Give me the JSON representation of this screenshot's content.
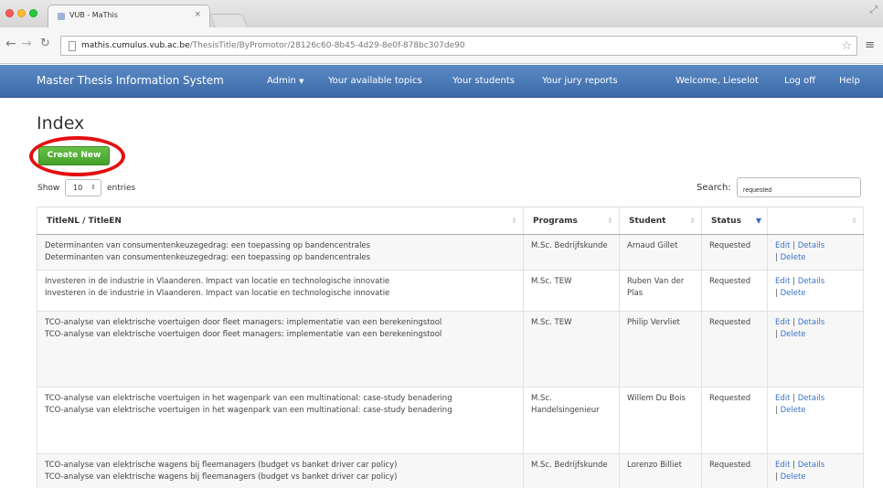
{
  "browser": {
    "tab_title": "VUB - MaThis",
    "tab_close": "×",
    "url_host": "mathis.cumulus.vub.ac.be",
    "url_path": "/ThesisTitle/ByPromotor/28126c60-8b45-4d29-8e0f-878bc307de90"
  },
  "navbar": {
    "brand": "Master Thesis Information System",
    "admin": "Admin",
    "topics": "Your available topics",
    "students": "Your students",
    "jury": "Your jury reports",
    "welcome": "Welcome, Lieselot",
    "logoff": "Log off",
    "help": "Help"
  },
  "page": {
    "title": "Index",
    "create_label": "Create New"
  },
  "controls": {
    "show_label": "Show",
    "page_size": "10",
    "entries_label": "entries",
    "search_label": "Search:",
    "search_value": "requested"
  },
  "table": {
    "headers": [
      "TitleNL / TitleEN",
      "Programs",
      "Student",
      "Status",
      ""
    ],
    "rows": [
      {
        "title_nl": "Determinanten van consumentenkeuzegedrag: een toepassing op bandencentrales",
        "title_en": "Determinanten van consumentenkeuzegedrag: een toepassing op bandencentrales",
        "program": "M.Sc. Bedrijfskunde",
        "student": "Arnaud Gillet",
        "status": "Requested"
      },
      {
        "title_nl": "Investeren in de industrie in Vlaanderen. Impact van locatie en technologische innovatie",
        "title_en": "Investeren in de industrie in Vlaanderen. Impact van locatie en technologische innovatie",
        "program": "M.Sc. TEW",
        "student": "Ruben Van der Plas",
        "status": "Requested"
      },
      {
        "title_nl": "TCO-analyse van elektrische voertuigen door fleet managers: implementatie van een berekeningstool",
        "title_en": "TCO-analyse van elektrische voertuigen door fleet managers: implementatie van een berekeningstool",
        "program": "M.Sc. TEW",
        "student": "Philip Vervliet",
        "status": "Requested"
      },
      {
        "title_nl": "TCO-analyse van elektrische voertuigen in het wagenpark van een multinational: case-study benadering",
        "title_en": "TCO-analyse van elektrische voertuigen in het wagenpark van een multinational: case-study benadering",
        "program": "M.Sc. Handelsingenieur",
        "student": "Willem Du Bois",
        "status": "Requested"
      },
      {
        "title_nl": "TCO-analyse van elektrische wagens bij fleemanagers (budget vs banket driver car policy)",
        "title_en": "TCO-analyse van elektrische wagens bij fleemanagers (budget vs banket driver car policy)",
        "program": "M.Sc. Bedrijfskunde",
        "student": "Lorenzo Billiet",
        "status": "Requested"
      }
    ],
    "actions": {
      "edit": "Edit",
      "details": "Details",
      "delete": "Delete",
      "separator": "|"
    }
  },
  "colors": {
    "navbar": "#4a79b8",
    "create_button": "#52b03a",
    "highlight_circle": "#e40f10",
    "link": "#3a73c6"
  }
}
